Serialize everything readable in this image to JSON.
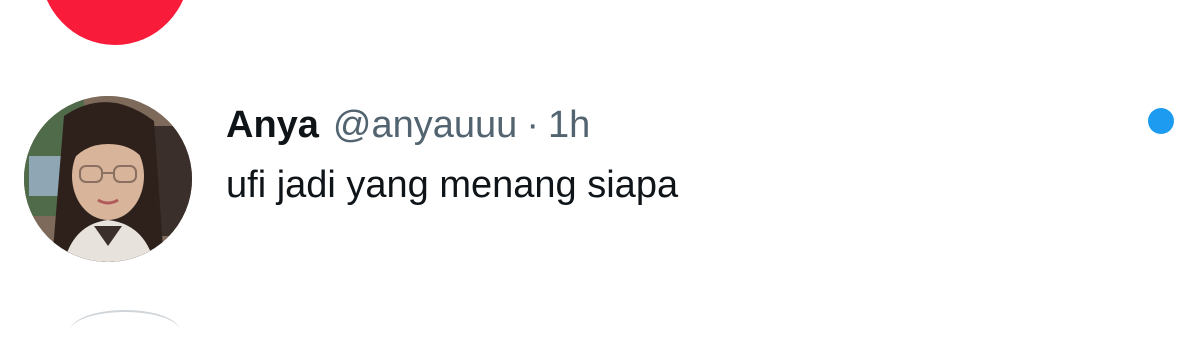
{
  "tweet": {
    "display_name": "Anya",
    "handle": "@anyauuu",
    "separator": "·",
    "timestamp": "1h",
    "text": "ufi jadi yang menang siapa",
    "avatar_icon": "profile-photo"
  },
  "colors": {
    "unread_dot": "#1d9bf0",
    "previous_avatar": "#f91b3a",
    "primary_text": "#0f1419",
    "secondary_text": "#536471"
  }
}
